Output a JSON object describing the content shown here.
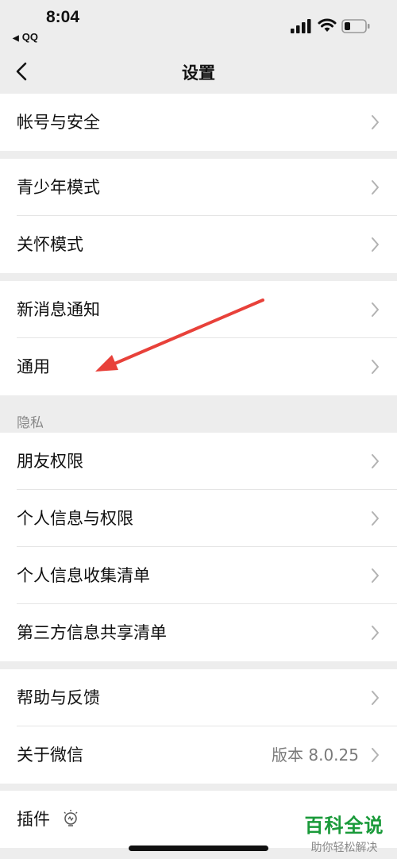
{
  "status_bar": {
    "time": "8:04",
    "back_app": "QQ",
    "back_arrow_icon": "triangle-left-icon",
    "icons": [
      "signal-icon",
      "wifi-icon",
      "battery-icon"
    ]
  },
  "nav": {
    "title": "设置",
    "back_icon": "chevron-left-icon"
  },
  "groups": [
    {
      "items": [
        {
          "label": "帐号与安全"
        }
      ]
    },
    {
      "items": [
        {
          "label": "青少年模式"
        },
        {
          "label": "关怀模式"
        }
      ]
    },
    {
      "items": [
        {
          "label": "新消息通知"
        },
        {
          "label": "通用"
        }
      ]
    },
    {
      "header": "隐私",
      "items": [
        {
          "label": "朋友权限"
        },
        {
          "label": "个人信息与权限"
        },
        {
          "label": "个人信息收集清单"
        },
        {
          "label": "第三方信息共享清单"
        }
      ]
    },
    {
      "items": [
        {
          "label": "帮助与反馈"
        },
        {
          "label": "关于微信",
          "value": "版本 8.0.25"
        }
      ]
    },
    {
      "items": [
        {
          "label": "插件",
          "icon": "lightbulb-icon"
        }
      ]
    }
  ],
  "watermark": {
    "main": "百科全说",
    "sub": "助你轻松解决"
  },
  "colors": {
    "background": "#ededed",
    "card": "#ffffff",
    "annotation_arrow": "#e8413a",
    "watermark_green": "#1a9a3a"
  }
}
